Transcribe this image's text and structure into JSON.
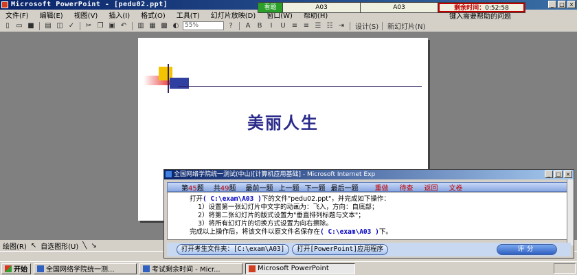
{
  "window": {
    "title": "Microsoft PowerPoint - [pedu02.ppt]",
    "btn_min": "_",
    "btn_max": "□",
    "btn_close": "×"
  },
  "timer": {
    "view_label": "看题",
    "folder1": "A03",
    "folder2": "A03",
    "remain_label": "剩余时间：",
    "remain_value": "0:52:58"
  },
  "menu": {
    "items": [
      "文件(F)",
      "编辑(E)",
      "视图(V)",
      "插入(I)",
      "格式(O)",
      "工具(T)",
      "幻灯片放映(D)",
      "窗口(W)",
      "帮助(H)"
    ],
    "help_box": "键入需要帮助的问题"
  },
  "toolbar": {
    "zoom": "55%",
    "design": "设计(S)",
    "new_slide": "新幻灯片(N)"
  },
  "slide": {
    "title": "美丽人生"
  },
  "drawbar": {
    "draw": "绘图(R)",
    "autoshape": "自选图形(U)"
  },
  "dialog": {
    "title": "全国网络学院统一测试(中山)[计算机应用基础] - Microsoft Internet Exp",
    "nav": {
      "current_prefix": "第",
      "current_num": "45",
      "current_suffix": "题",
      "total_prefix": "共",
      "total_num": "49",
      "total_suffix": "题",
      "first": "最前一题",
      "prev": "上一题",
      "next": "下一题",
      "last": "最后一题",
      "redo": "重做",
      "pending": "待查",
      "back": "返回",
      "exam": "文卷"
    },
    "body": {
      "line1_pre": "打开",
      "line1_path": "( C:\\exam\\A03 )",
      "line1_post": "下的文件\"pedu02.ppt\"，并完成如下操作：",
      "step1": "1）设置第一张幻灯片中文字的动画为：飞入，方向：自底部；",
      "step2": "2）将第二张幻灯片的版式设置为\"垂直排列标题与文本\"；",
      "step3": "3）将所有幻灯片的切换方式设置为向右擦除。",
      "line5_pre": "完成以上操作后，将该文件以原文件名保存在",
      "line5_path": "( C:\\exam\\A03 )",
      "line5_post": "下。"
    },
    "buttons": {
      "open_folder": "打开考生文件夹：[C:\\exam\\A03]",
      "open_app": "打开[PowerPoint]应用程序",
      "score": "评分"
    }
  },
  "taskbar": {
    "start": "开始",
    "tasks": [
      "全国网络学院统一测...",
      "考试剩余时间 - Micr...",
      "Microsoft PowerPoint"
    ]
  }
}
